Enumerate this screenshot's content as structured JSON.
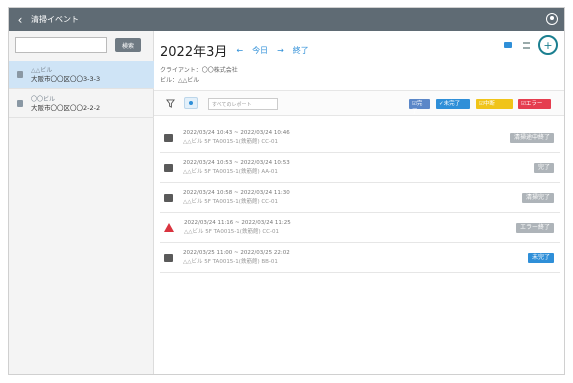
{
  "topbar": {
    "back_glyph": "‹",
    "title": "清掃イベント"
  },
  "sidebar": {
    "search": {
      "value": "",
      "placeholder": ""
    },
    "search_button": "検索",
    "buildings": [
      {
        "name": "△△ビル",
        "address": "大阪市〇〇区〇〇3-3-3"
      },
      {
        "name": "〇〇ビル",
        "address": "大阪市〇〇区〇〇2-2-2"
      }
    ]
  },
  "main": {
    "month_title": "2022年3月",
    "prev_arrow": "←",
    "today": "今日",
    "next_arrow": "→",
    "last": "終了",
    "client": "クライアント：〇〇株式会社",
    "building": "ビル：△△ビル",
    "add_glyph": "+",
    "report_select": {
      "value": "すべてのレポート"
    },
    "chips": {
      "done": "☑完了",
      "undone": "✓未完了",
      "paused": "☑中断",
      "error": "☑エラー"
    }
  },
  "events": [
    {
      "time": "2022/03/24 10:43 ~ 2022/03/24 10:46",
      "location": "△△ビル 5F TA0015-1(鉄筋館) CC-01",
      "status": "清掃途中終了",
      "type": "normal"
    },
    {
      "time": "2022/03/24 10:53 ~ 2022/03/24 10:53",
      "location": "△△ビル 5F TA0015-1(鉄筋館) AA-01",
      "status": "完了",
      "type": "normal"
    },
    {
      "time": "2022/03/24 10:58 ~ 2022/03/24 11:30",
      "location": "△△ビル 5F TA0015-1(鉄筋館) CC-01",
      "status": "清掃完了",
      "type": "normal"
    },
    {
      "time": "2022/03/24 11:16 ~ 2022/03/24 11:25",
      "location": "△△ビル 5F TA0015-1(鉄筋館) CC-01",
      "status": "エラー終了",
      "type": "warning"
    },
    {
      "time": "2022/03/25 11:00 ~ 2022/03/25 22:02",
      "location": "△△ビル 5F TA0015-1(鉄筋館) BB-01",
      "status": "未完了",
      "type": "undone"
    }
  ],
  "colors": {
    "topbar": "#5f6b74",
    "accent": "#2f8fd8",
    "add_ring": "#1b7f90",
    "error": "#e53d4f",
    "paused": "#f0c419"
  },
  "icons": {
    "back": "chevron-left-icon",
    "user": "user-circle-icon",
    "filter": "funnel-icon",
    "eye": "eye-icon",
    "add": "plus-icon"
  }
}
